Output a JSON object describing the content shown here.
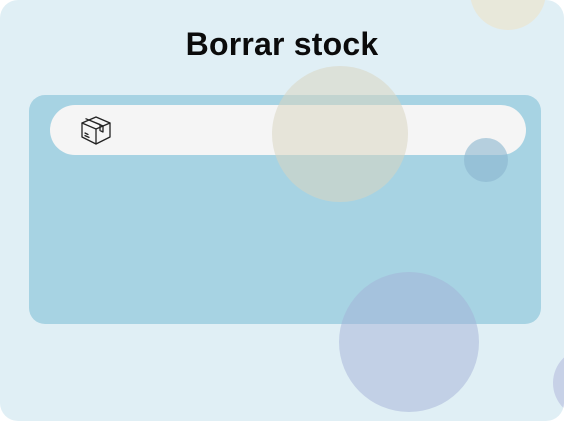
{
  "page": {
    "title": "Borrar stock"
  },
  "form": {
    "stock_field": {
      "value": "",
      "placeholder": "",
      "icon": "box-icon"
    }
  },
  "colors": {
    "background": "#e0eff5",
    "panel": "#a6d3e2",
    "field": "#f5f5f5",
    "title": "#0b0b0b"
  }
}
